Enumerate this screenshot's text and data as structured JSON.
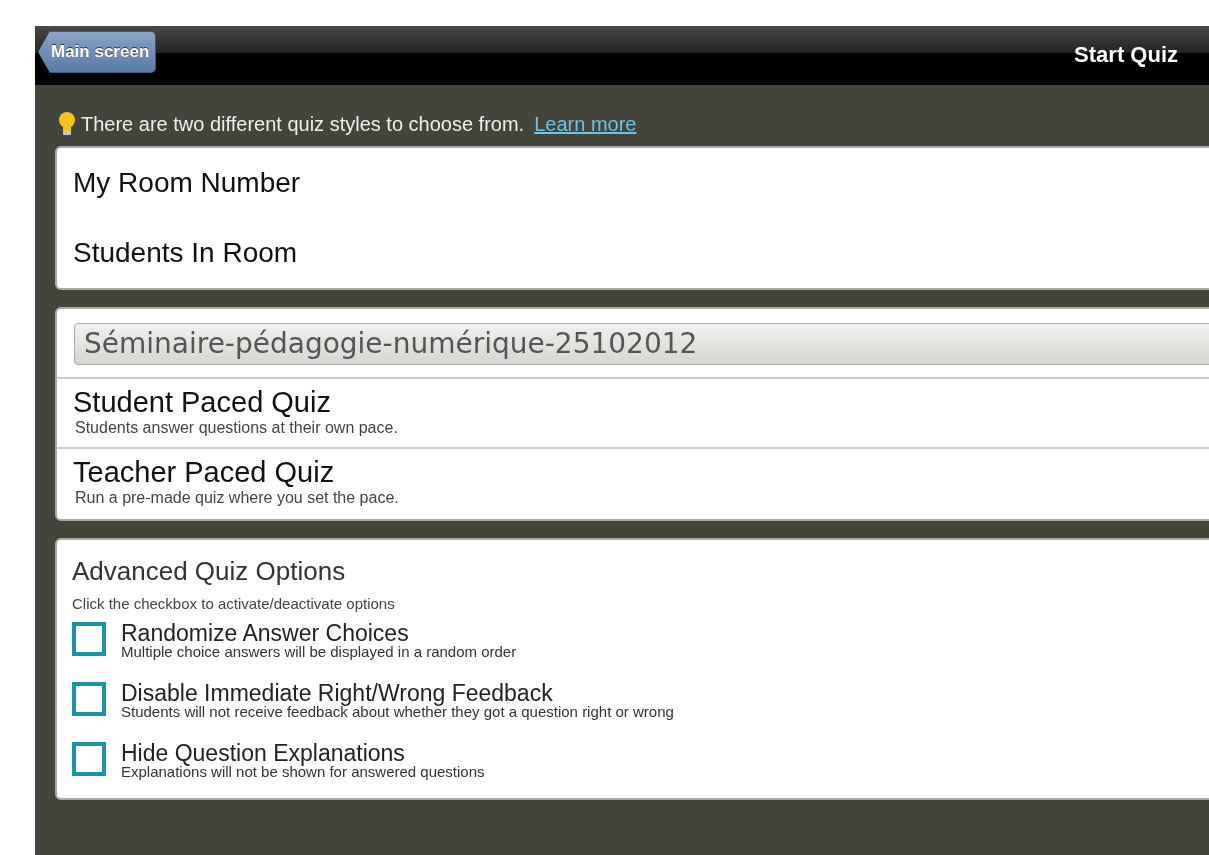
{
  "header": {
    "back_button": "Main screen",
    "title": "Start Quiz"
  },
  "tip": {
    "text": "There are two different quiz styles to choose from.",
    "link": "Learn more"
  },
  "room": [
    {
      "label": "My Room Number"
    },
    {
      "label": "Students In Room"
    }
  ],
  "quiz_select": {
    "value": "Séminaire-pédagogie-numérique-25102012"
  },
  "quiz_styles": [
    {
      "title": "Student Paced Quiz",
      "description": "Students answer questions at their own pace."
    },
    {
      "title": "Teacher Paced Quiz",
      "description": "Run a pre-made quiz where you set the pace."
    }
  ],
  "advanced": {
    "title": "Advanced Quiz Options",
    "hint": "Click the checkbox to activate/deactivate options",
    "options": [
      {
        "label": "Randomize Answer Choices",
        "description": "Multiple choice answers will be displayed in a random order",
        "checked": false
      },
      {
        "label": "Disable Immediate Right/Wrong Feedback",
        "description": "Students will not receive feedback about whether they got a question right or wrong",
        "checked": false
      },
      {
        "label": "Hide Question Explanations",
        "description": "Explanations will not be shown for answered questions",
        "checked": false
      }
    ]
  }
}
